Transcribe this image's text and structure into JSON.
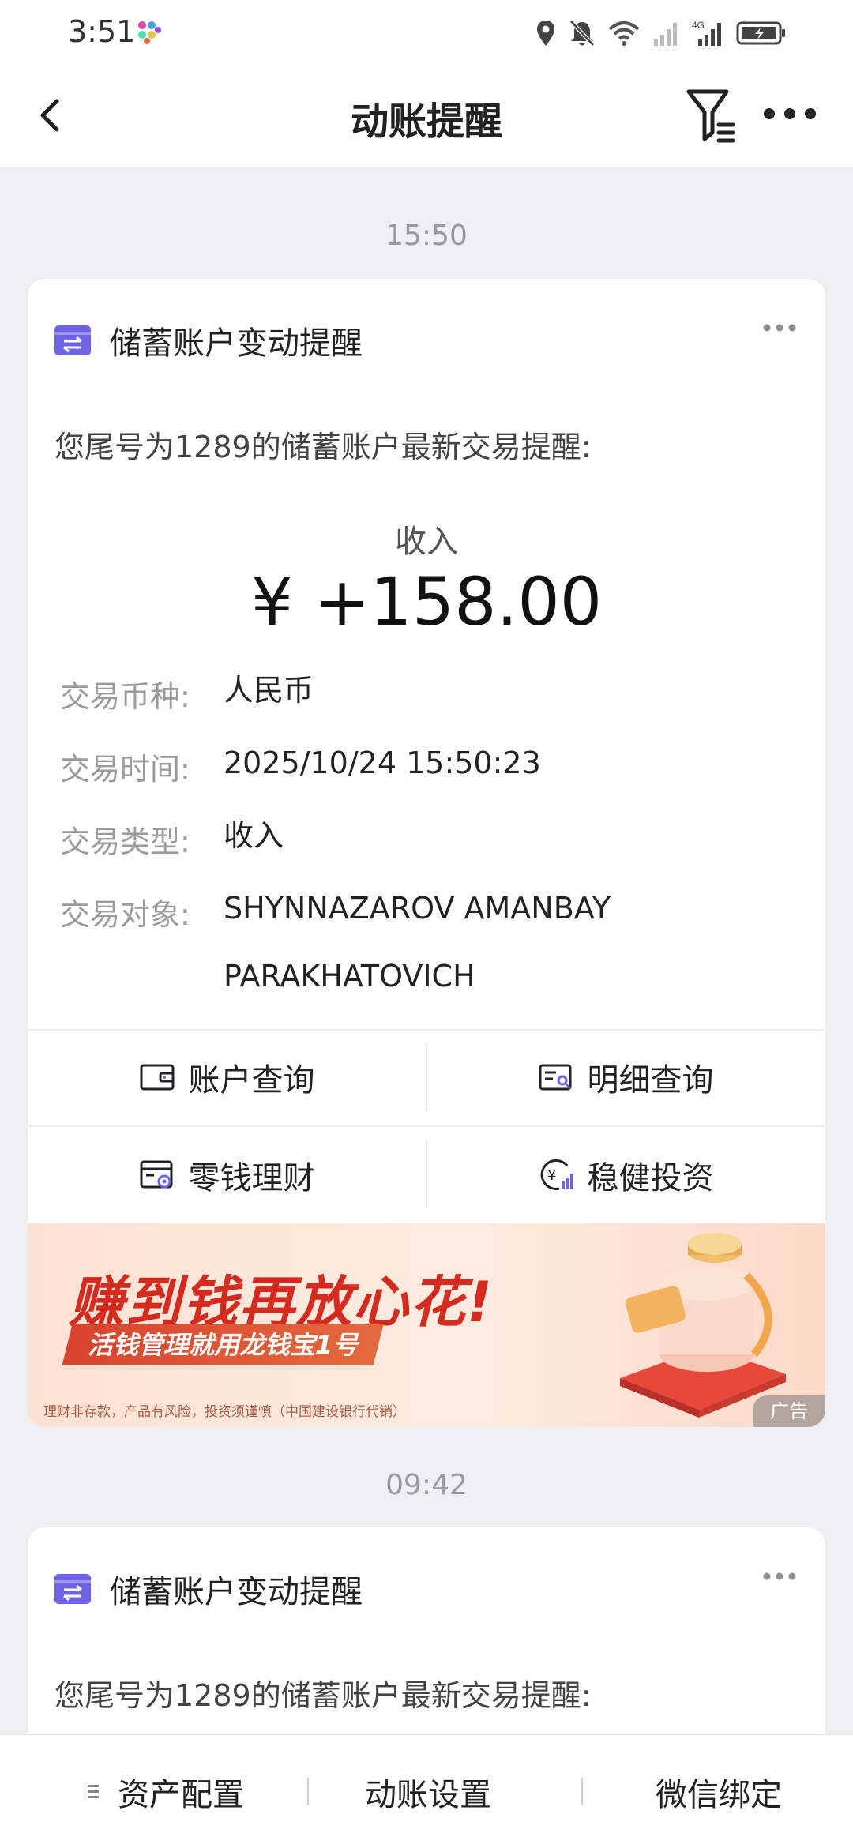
{
  "status_bar": {
    "time": "3:51",
    "icons": [
      "app-notification-icon",
      "location-icon",
      "bell-muted-icon",
      "wifi-icon",
      "signal-icon",
      "signal-4g-icon",
      "battery-charging-icon"
    ]
  },
  "header": {
    "title": "动账提醒",
    "icons": [
      "back-icon",
      "filter-icon",
      "more-icon"
    ]
  },
  "messages": [
    {
      "time": "15:50",
      "card_title": "储蓄账户变动提醒",
      "intro": "您尾号为1289的储蓄账户最新交易提醒:",
      "type_heading": "收入",
      "amount": "¥ +158.00",
      "fields": [
        {
          "label": "交易币种:",
          "value": "人民币"
        },
        {
          "label": "交易时间:",
          "value": "2025/10/24 15:50:23"
        },
        {
          "label": "交易类型:",
          "value": "收入"
        },
        {
          "label": "交易对象:",
          "value": "SHYNNAZAROV AMANBAY PARAKHATOVICH"
        }
      ],
      "actions": [
        {
          "label": "账户查询",
          "icon": "wallet-icon"
        },
        {
          "label": "明细查询",
          "icon": "detail-search-icon"
        },
        {
          "label": "零钱理财",
          "icon": "change-finance-icon"
        },
        {
          "label": "稳健投资",
          "icon": "yuan-invest-icon"
        }
      ],
      "ad": {
        "headline": "赚到钱再放心花!",
        "subline": "活钱管理就用龙钱宝1号",
        "disclaimer": "理财非存款，产品有风险，投资须谨慎（中国建设银行代销）",
        "tag": "广告"
      }
    },
    {
      "time": "09:42",
      "card_title": "储蓄账户变动提醒",
      "intro": "您尾号为1289的储蓄账户最新交易提醒:"
    }
  ],
  "bottom_bar": {
    "items": [
      "资产配置",
      "动账设置",
      "微信绑定"
    ]
  },
  "colors": {
    "accent_purple": "#6c63e6",
    "brand_red": "#d62a1f",
    "background": "#efeff1"
  }
}
